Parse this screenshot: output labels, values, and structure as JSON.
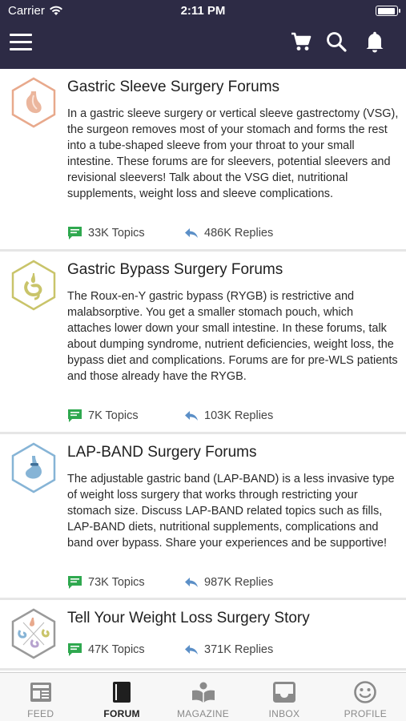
{
  "status_bar": {
    "carrier": "Carrier",
    "time": "2:11 PM",
    "battery_level": 0.95
  },
  "forums": [
    {
      "title": "Gastric Sleeve Surgery Forums",
      "description": "In a gastric sleeve surgery or vertical sleeve gastrectomy (VSG), the surgeon removes most of your stomach and forms the rest into a tube-shaped sleeve from your throat to your small intestine. These forums are for sleevers, potential sleevers and revisional sleevers! Talk about the VSG diet, nutritional supplements, weight loss and sleeve complications.",
      "topics": "33K Topics",
      "replies": "486K Replies",
      "badge_color": "#e8a98c",
      "icon": "stomach-sleeve-icon"
    },
    {
      "title": "Gastric Bypass Surgery Forums",
      "description": "The Roux-en-Y gastric bypass (RYGB) is restrictive and malabsorptive. You get a smaller stomach pouch, which attaches lower down your small intestine. In these forums, talk about dumping syndrome, nutrient deficiencies, weight loss, the bypass diet and complications. Forums are for pre-WLS patients and those already have the RYGB.",
      "topics": "7K Topics",
      "replies": "103K Replies",
      "badge_color": "#c9c46a",
      "icon": "stomach-bypass-icon"
    },
    {
      "title": "LAP-BAND Surgery Forums",
      "description": "The adjustable gastric band (LAP-BAND) is a less invasive type of weight loss surgery that works through restricting your stomach size. Discuss LAP-BAND related topics such as fills, LAP-BAND diets, nutritional supplements, complications and band over bypass. Share your experiences and be supportive!",
      "topics": "73K Topics",
      "replies": "987K Replies",
      "badge_color": "#86b4d6",
      "icon": "stomach-band-icon"
    },
    {
      "title": "Tell Your Weight Loss Surgery Story",
      "description": "",
      "topics": "47K Topics",
      "replies": "371K Replies",
      "badge_color": "#9a9a9a",
      "icon": "stories-icon"
    }
  ],
  "tabs": [
    {
      "label": "FEED",
      "icon": "feed-icon",
      "active": false
    },
    {
      "label": "FORUM",
      "icon": "forum-book-icon",
      "active": true
    },
    {
      "label": "MAGAZINE",
      "icon": "magazine-icon",
      "active": false
    },
    {
      "label": "INBOX",
      "icon": "inbox-icon",
      "active": false
    },
    {
      "label": "PROFILE",
      "icon": "profile-smiley-icon",
      "active": false
    }
  ],
  "colors": {
    "header_bg": "#2d2b45",
    "topics_icon": "#2fa84f",
    "replies_icon": "#5b8fc7",
    "tab_inactive": "#8a8a8a",
    "tab_active": "#1f1f1f"
  }
}
